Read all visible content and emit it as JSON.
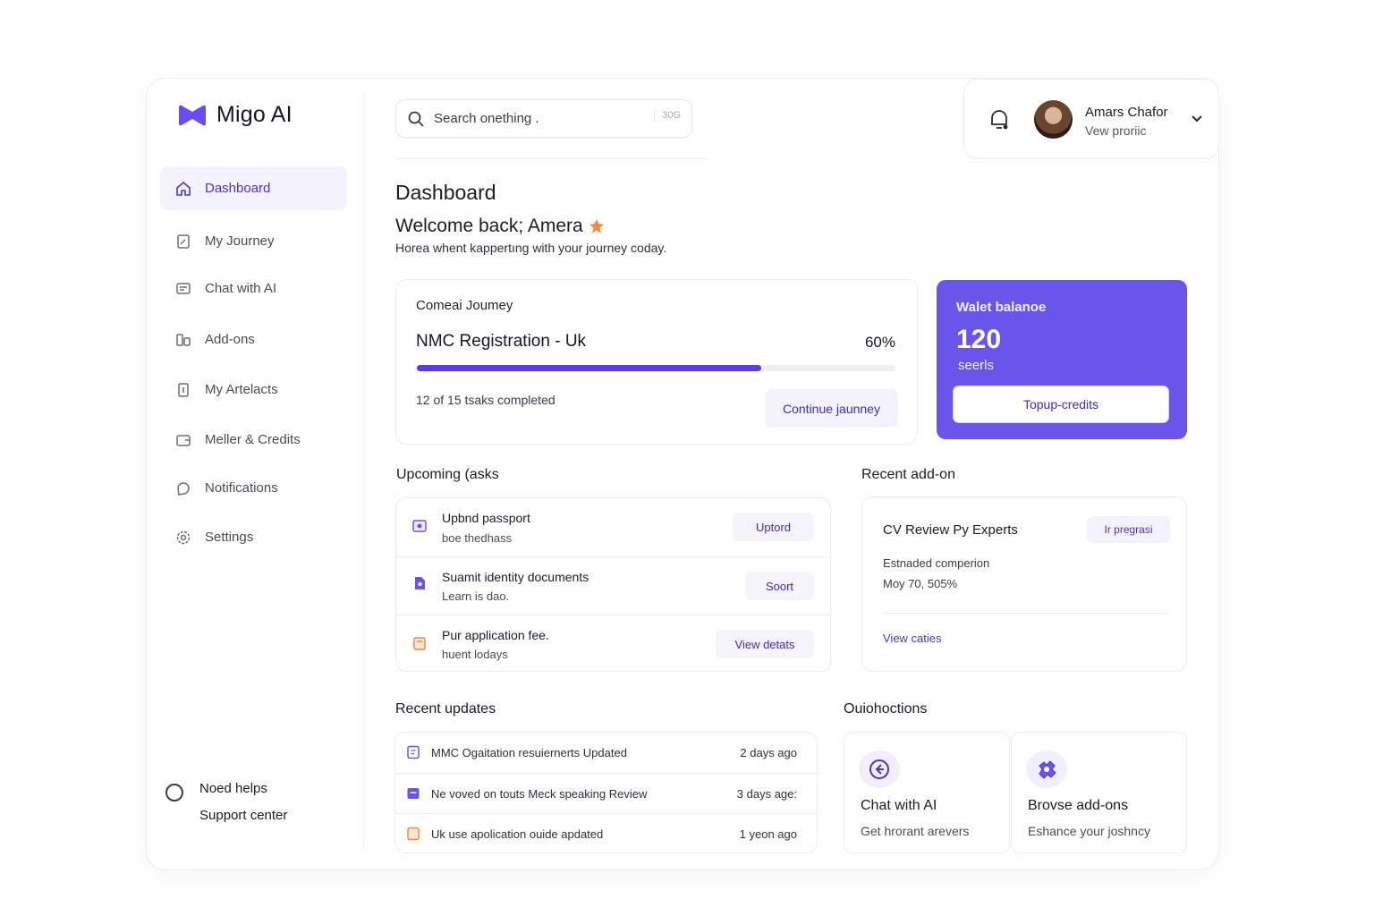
{
  "app": {
    "name": "Migo AI"
  },
  "sidebar": {
    "items": [
      {
        "label": "Dashboard",
        "icon": "home-icon",
        "active": true
      },
      {
        "label": "My Journey",
        "icon": "journey-icon",
        "active": false
      },
      {
        "label": "Chat with AI",
        "icon": "chat-icon",
        "active": false
      },
      {
        "label": "Add-ons",
        "icon": "addons-icon",
        "active": false
      },
      {
        "label": "My Artelacts",
        "icon": "document-icon",
        "active": false
      },
      {
        "label": "Meller & Credits",
        "icon": "wallet-icon",
        "active": false
      },
      {
        "label": "Notifications",
        "icon": "bell-icon",
        "active": false
      },
      {
        "label": "Settings",
        "icon": "gear-icon",
        "active": false
      }
    ],
    "help": {
      "title": "Noed helps",
      "link": "Support center"
    }
  },
  "search": {
    "placeholder": "Search onething .",
    "shortcut": "30G"
  },
  "user": {
    "name": "Amars Chafor",
    "role": "Vew proriic"
  },
  "header": {
    "title": "Dashboard",
    "welcome": "Welcome back; Amera",
    "subtitle": "Horea whent kappertıng with your journey coday."
  },
  "journey": {
    "label": "Comeai Joumey",
    "title": "NMC Registration - Uk",
    "progress_text": "60%",
    "progress": 0.6,
    "tasks_text": "12 of 15 tsaks completed",
    "button": "Continue jaunney"
  },
  "wallet": {
    "title": "Walet balanoe",
    "value": "120",
    "unit": "seerls",
    "button": "Topup-credits"
  },
  "sections": {
    "tasks": "Upcoming (asks",
    "addon": "Recent add-on",
    "updates": "Recent updates",
    "quick": "Ouiohoctions"
  },
  "tasks": [
    {
      "title": "Upbnd passport",
      "sub": "boe thedhass",
      "action": "Uptord",
      "icon": "passport-icon",
      "color": "#6a55ea"
    },
    {
      "title": "Suamit identity documents",
      "sub": "Learn is dao.",
      "action": "Soort",
      "icon": "identity-icon",
      "color": "#6a55ea"
    },
    {
      "title": "Pur application fee.",
      "sub": "huent lodays",
      "action": "View detats",
      "icon": "fee-icon",
      "color": "#f08a3c"
    }
  ],
  "addon": {
    "title": "CV Review Py Experts",
    "status": "Ir pregrasi",
    "line1": "Estnaded comperion",
    "line2": "Moy 70, 505%",
    "link": "View caties"
  },
  "updates": [
    {
      "text": "MMC Ogaitation resuiernerts Updated",
      "time": "2 days ago",
      "color": "#6a55ea"
    },
    {
      "text": "Ne voved on touts Meck speaking Review",
      "time": "3 days age:",
      "color": "#6a55ea"
    },
    {
      "text": "Uk use apolication ouide apdated",
      "time": "1 yeon ago",
      "color": "#f08a3c"
    }
  ],
  "quick_actions": [
    {
      "title": "Chat with AI",
      "sub": "Get hrorant arevers",
      "icon": "chat-arrow-icon"
    },
    {
      "title": "Brovse add-ons",
      "sub": "Eshance your joshncy",
      "icon": "puzzle-icon"
    }
  ],
  "colors": {
    "accent": "#5b3be6",
    "wallet": "#6a55ea",
    "orange": "#f08a3c"
  }
}
